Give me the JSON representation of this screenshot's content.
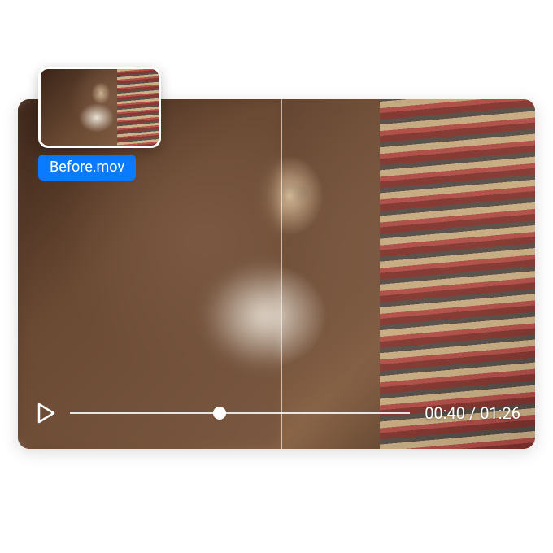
{
  "thumbnail": {
    "filename": "Before.mov"
  },
  "player": {
    "current_time": "00:40",
    "duration": "01:26",
    "progress_percent": 44,
    "split_position_percent": 51
  },
  "colors": {
    "accent": "#0a7bff"
  }
}
